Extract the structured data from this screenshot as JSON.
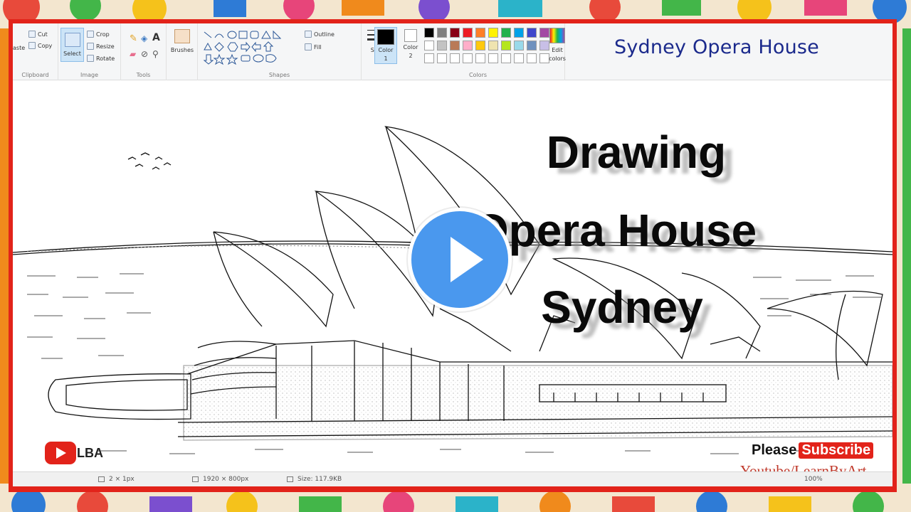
{
  "ribbon": {
    "clipboard": {
      "paste": "aste",
      "cut": "Cut",
      "copy": "Copy",
      "label": "Clipboard"
    },
    "image": {
      "select": "Select",
      "crop": "Crop",
      "resize": "Resize",
      "rotate": "Rotate",
      "label": "Image"
    },
    "tools": {
      "label": "Tools"
    },
    "brushes": {
      "label": "Brushes"
    },
    "shapes": {
      "outline": "Outline",
      "fill": "Fill",
      "label": "Shapes"
    },
    "size": {
      "label": "Size"
    },
    "color1": {
      "label": "Color",
      "num": "1"
    },
    "color2": {
      "label": "Color",
      "num": "2"
    },
    "edit_colors": {
      "line1": "Edit",
      "line2": "colors"
    },
    "colors": {
      "label": "Colors"
    }
  },
  "palette": [
    "#000000",
    "#7f7f7f",
    "#880015",
    "#ed1c24",
    "#ff7f27",
    "#fff200",
    "#22b14c",
    "#00a2e8",
    "#3f48cc",
    "#a349a4",
    "#ffffff",
    "#c3c3c3",
    "#b97a57",
    "#ffaec9",
    "#ffc90e",
    "#efe4b0",
    "#b5e61d",
    "#99d9ea",
    "#7092be",
    "#c8bfe7"
  ],
  "color1_value": "#000000",
  "color2_value": "#ffffff",
  "header_title": "Sydney Opera House",
  "overlay": {
    "line1": "Drawing",
    "line2": "Opera  House",
    "line3": "Sydney"
  },
  "logo_text": "LBA",
  "subscribe": {
    "please": "Please",
    "button": "Subscribe",
    "channel": "Youtube/LearnByArt"
  },
  "status": {
    "cursor": "2 × 1px",
    "dimensions": "1920 × 800px",
    "size": "Size: 117.9KB",
    "zoom": "100%"
  }
}
